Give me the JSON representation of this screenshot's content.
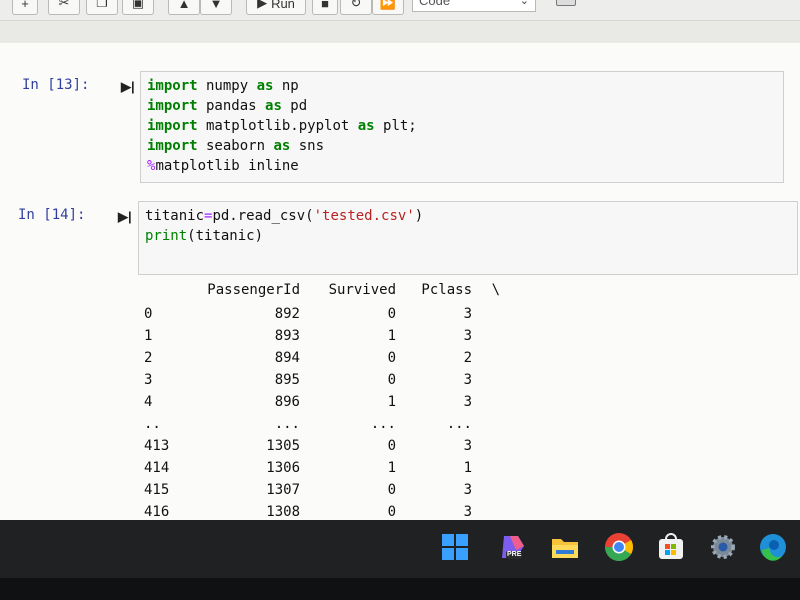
{
  "toolbar": {
    "run_label": "Run",
    "cell_type": "Code"
  },
  "cells": [
    {
      "prompt": "In [13]:",
      "lines": [
        [
          {
            "t": "import",
            "c": "kw"
          },
          {
            "t": " numpy ",
            "c": ""
          },
          {
            "t": "as",
            "c": "kw"
          },
          {
            "t": " np",
            "c": ""
          }
        ],
        [
          {
            "t": "import",
            "c": "kw"
          },
          {
            "t": " pandas ",
            "c": ""
          },
          {
            "t": "as",
            "c": "kw"
          },
          {
            "t": " pd",
            "c": ""
          }
        ],
        [
          {
            "t": "import",
            "c": "kw"
          },
          {
            "t": " matplotlib.pyplot ",
            "c": ""
          },
          {
            "t": "as",
            "c": "kw"
          },
          {
            "t": " plt;",
            "c": ""
          }
        ],
        [
          {
            "t": "import",
            "c": "kw"
          },
          {
            "t": " seaborn ",
            "c": ""
          },
          {
            "t": "as",
            "c": "kw"
          },
          {
            "t": " sns",
            "c": ""
          }
        ],
        [
          {
            "t": "%",
            "c": "magic"
          },
          {
            "t": "matplotlib inline",
            "c": ""
          }
        ]
      ]
    },
    {
      "prompt": "In [14]:",
      "lines": [
        [
          {
            "t": "titanic",
            "c": ""
          },
          {
            "t": "=",
            "c": "op"
          },
          {
            "t": "pd.read_csv(",
            "c": ""
          },
          {
            "t": "'tested.csv'",
            "c": "str"
          },
          {
            "t": ")",
            "c": ""
          }
        ],
        [
          {
            "t": "print",
            "c": "bi"
          },
          {
            "t": "(titanic)",
            "c": ""
          }
        ]
      ]
    }
  ],
  "output": {
    "header": [
      "PassengerId",
      "Survived",
      "Pclass",
      "\\"
    ],
    "rows": [
      [
        "0",
        "892",
        "0",
        "3"
      ],
      [
        "1",
        "893",
        "1",
        "3"
      ],
      [
        "2",
        "894",
        "0",
        "2"
      ],
      [
        "3",
        "895",
        "0",
        "3"
      ],
      [
        "4",
        "896",
        "1",
        "3"
      ],
      [
        "..",
        "...",
        "...",
        "..."
      ],
      [
        "413",
        "1305",
        "0",
        "3"
      ],
      [
        "414",
        "1306",
        "1",
        "1"
      ],
      [
        "415",
        "1307",
        "0",
        "3"
      ],
      [
        "416",
        "1308",
        "0",
        "3"
      ]
    ]
  },
  "taskbar": {
    "icons": [
      "windows-start-icon",
      "microsoft-365-icon",
      "file-explorer-icon",
      "chrome-icon",
      "microsoft-store-icon",
      "settings-icon",
      "edge-icon"
    ],
    "badge": "PRE"
  }
}
